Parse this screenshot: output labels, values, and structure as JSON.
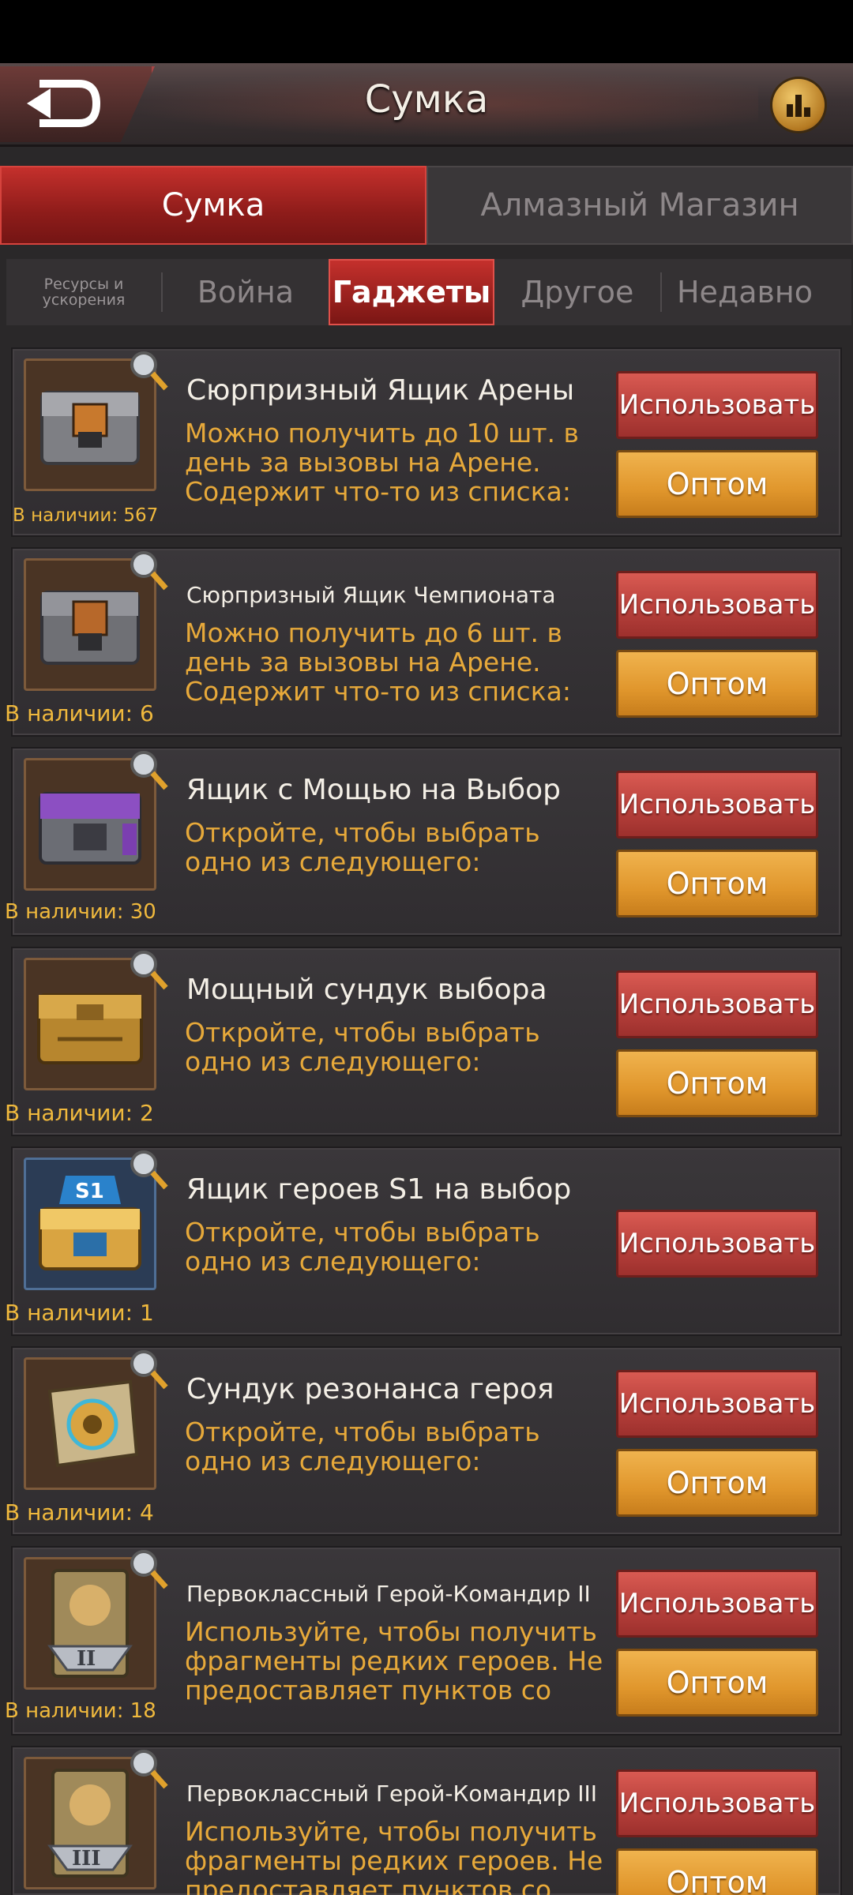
{
  "header": {
    "title": "Сумка",
    "back_icon": "back-arrow-icon",
    "stats_icon": "bar-chart-icon"
  },
  "main_tabs": [
    {
      "label": "Сумка",
      "active": true
    },
    {
      "label": "Алмазный Магазин",
      "active": false
    }
  ],
  "sub_tabs": [
    {
      "label": "Ресурсы и ускорения",
      "active": false
    },
    {
      "label": "Война",
      "active": false
    },
    {
      "label": "Гаджеты",
      "active": true
    },
    {
      "label": "Другое",
      "active": false
    },
    {
      "label": "Недавно",
      "active": false
    }
  ],
  "buttons": {
    "use": "Использовать",
    "bulk": "Оптом"
  },
  "items": [
    {
      "title": "Сюрпризный Ящик Арены",
      "desc": "Можно получить до 10 шт. в день за вызовы на Арене. Содержит что-то из списка:",
      "count": "В наличии: 567",
      "icon": "arena-chest-icon"
    },
    {
      "title": "Сюрпризный Ящик Чемпионата",
      "desc": "Можно получить до 6 шт. в день за вызовы на Арене. Содержит что-то из списка:",
      "count": "В наличии: 6",
      "icon": "championship-chest-icon"
    },
    {
      "title": "Ящик с Мощью на Выбор",
      "desc": "Откройте, чтобы выбрать одно из следующего:",
      "count": "В наличии: 30",
      "icon": "power-chest-icon"
    },
    {
      "title": "Мощный сундук выбора",
      "desc": "Откройте, чтобы выбрать одно из следующего:",
      "count": "В наличии: 2",
      "icon": "gold-chest-icon"
    },
    {
      "title": "Ящик героев S1 на выбор",
      "desc": "Откройте, чтобы выбрать одно из следующего:",
      "count": "В наличии: 1",
      "icon": "s1-hero-chest-icon"
    },
    {
      "title": "Сундук резонанса героя",
      "desc": "Откройте, чтобы выбрать одно из следующего:",
      "count": "В наличии: 4",
      "icon": "resonance-chest-icon"
    },
    {
      "title": "Первоклассный Герой-Командир II",
      "desc": "Используйте, чтобы получить фрагменты редких героев. Не предоставляет пунктов со",
      "count": "В наличии: 18",
      "icon": "commander-ii-icon"
    },
    {
      "title": "Первоклассный Герой-Командир III",
      "desc": "Используйте, чтобы получить фрагменты редких героев. Не предоставляет пунктов со",
      "count": "",
      "icon": "commander-iii-icon"
    }
  ],
  "colors": {
    "accent_red": "#c4302c",
    "accent_orange": "#e0962c",
    "desc_text": "#e7a93a"
  }
}
